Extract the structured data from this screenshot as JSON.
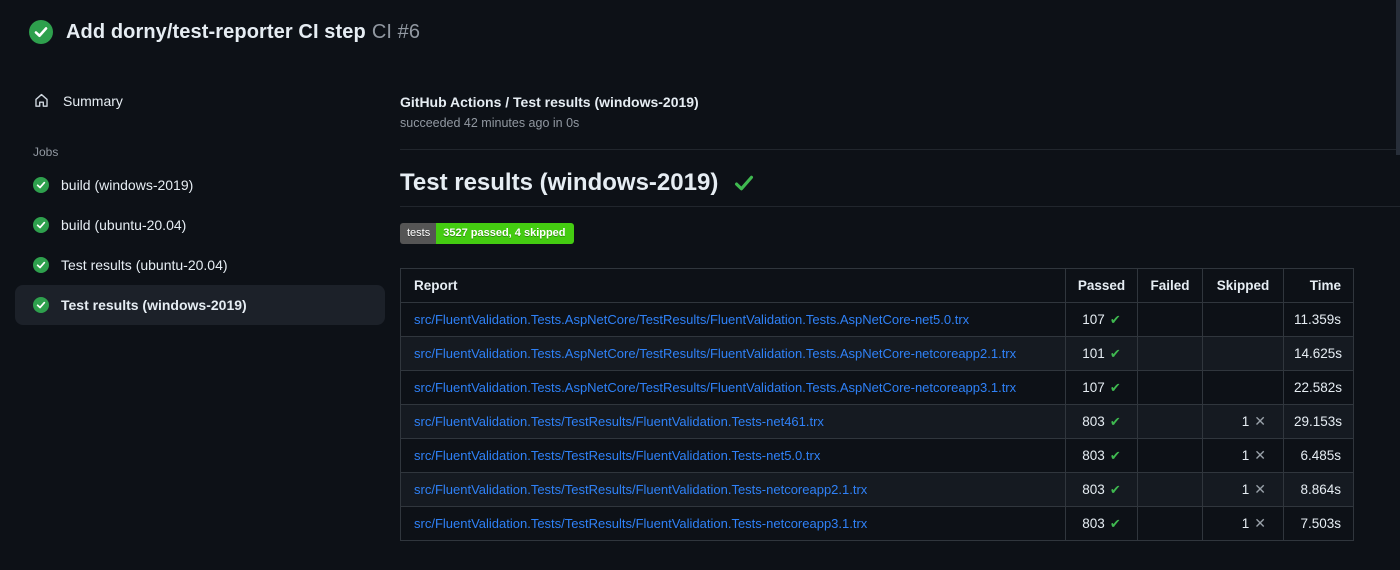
{
  "header": {
    "title": "Add dorny/test-reporter CI step",
    "run_number": "CI #6"
  },
  "sidebar": {
    "summary_label": "Summary",
    "jobs_label": "Jobs",
    "jobs": [
      {
        "label": "build (windows-2019)",
        "selected": false
      },
      {
        "label": "build (ubuntu-20.04)",
        "selected": false
      },
      {
        "label": "Test results (ubuntu-20.04)",
        "selected": false
      },
      {
        "label": "Test results (windows-2019)",
        "selected": true
      }
    ]
  },
  "main": {
    "check_title": "GitHub Actions / Test results (windows-2019)",
    "check_status": "succeeded 42 minutes ago in 0s",
    "section_title": "Test results (windows-2019)",
    "badge": {
      "label": "tests",
      "value": "3527 passed, 4 skipped",
      "label_bg": "#555555",
      "value_bg": "#44cc11"
    },
    "table": {
      "columns": [
        "Report",
        "Passed",
        "Failed",
        "Skipped",
        "Time"
      ],
      "rows": [
        {
          "report": "src/FluentValidation.Tests.AspNetCore/TestResults/FluentValidation.Tests.AspNetCore-net5.0.trx",
          "passed": "107",
          "failed": "",
          "skipped": "",
          "time": "11.359s"
        },
        {
          "report": "src/FluentValidation.Tests.AspNetCore/TestResults/FluentValidation.Tests.AspNetCore-netcoreapp2.1.trx",
          "passed": "101",
          "failed": "",
          "skipped": "",
          "time": "14.625s"
        },
        {
          "report": "src/FluentValidation.Tests.AspNetCore/TestResults/FluentValidation.Tests.AspNetCore-netcoreapp3.1.trx",
          "passed": "107",
          "failed": "",
          "skipped": "",
          "time": "22.582s"
        },
        {
          "report": "src/FluentValidation.Tests/TestResults/FluentValidation.Tests-net461.trx",
          "passed": "803",
          "failed": "",
          "skipped": "1",
          "time": "29.153s"
        },
        {
          "report": "src/FluentValidation.Tests/TestResults/FluentValidation.Tests-net5.0.trx",
          "passed": "803",
          "failed": "",
          "skipped": "1",
          "time": "6.485s"
        },
        {
          "report": "src/FluentValidation.Tests/TestResults/FluentValidation.Tests-netcoreapp2.1.trx",
          "passed": "803",
          "failed": "",
          "skipped": "1",
          "time": "8.864s"
        },
        {
          "report": "src/FluentValidation.Tests/TestResults/FluentValidation.Tests-netcoreapp3.1.trx",
          "passed": "803",
          "failed": "",
          "skipped": "1",
          "time": "7.503s"
        }
      ]
    }
  },
  "icons": {
    "status_success": "check-circle-icon",
    "summary": "home-icon",
    "passed_mark": "✔",
    "skipped_mark": "✕",
    "heading_mark": "check-icon"
  },
  "colors": {
    "background": "#0d1117",
    "text_primary": "#e6edf3",
    "text_muted": "#9198a1",
    "link": "#2f81f7",
    "success_circle": "#2ea04d",
    "success_check": "#3fb950",
    "border": "#30363d",
    "row_alt": "#151a21",
    "selected_item_bg": "#1c2129"
  }
}
